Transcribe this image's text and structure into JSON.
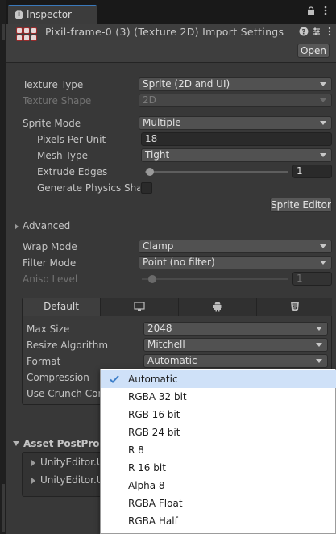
{
  "window": {
    "tab_label": "Inspector"
  },
  "header": {
    "title": "Pixil-frame-0 (3) (Texture 2D) Import Settings",
    "open_button": "Open"
  },
  "fields": {
    "texture_type": {
      "label": "Texture Type",
      "value": "Sprite (2D and UI)"
    },
    "texture_shape": {
      "label": "Texture Shape",
      "value": "2D"
    },
    "sprite_mode": {
      "label": "Sprite Mode",
      "value": "Multiple"
    },
    "pixels_per_unit": {
      "label": "Pixels Per Unit",
      "value": "18"
    },
    "mesh_type": {
      "label": "Mesh Type",
      "value": "Tight"
    },
    "extrude_edges": {
      "label": "Extrude Edges",
      "value": "1",
      "slider_fraction": 0.0
    },
    "generate_physics_shape": {
      "label": "Generate Physics Shap",
      "checked": false
    },
    "sprite_editor_button": "Sprite Editor",
    "advanced": {
      "label": "Advanced",
      "expanded": false
    },
    "wrap_mode": {
      "label": "Wrap Mode",
      "value": "Clamp"
    },
    "filter_mode": {
      "label": "Filter Mode",
      "value": "Point (no filter)"
    },
    "aniso_level": {
      "label": "Aniso Level",
      "value": "1",
      "slider_fraction": 0.0
    }
  },
  "platforms": {
    "tabs": [
      {
        "label": "Default",
        "icon": "",
        "selected": true
      },
      {
        "label": "",
        "icon": "monitor-icon",
        "selected": false
      },
      {
        "label": "",
        "icon": "android-icon",
        "selected": false
      },
      {
        "label": "",
        "icon": "html5-icon",
        "selected": false
      }
    ],
    "max_size": {
      "label": "Max Size",
      "value": "2048"
    },
    "resize_algorithm": {
      "label": "Resize Algorithm",
      "value": "Mitchell"
    },
    "format": {
      "label": "Format",
      "value": "Automatic"
    },
    "compression": {
      "label": "Compression"
    },
    "use_crunch": {
      "label": "Use Crunch Con"
    }
  },
  "postprocessor": {
    "title": "Asset PostProce",
    "items": [
      "UnityEditor.U",
      "UnityEditor.U"
    ]
  },
  "format_popup": {
    "selected": "Automatic",
    "options": [
      "Automatic",
      "RGBA 32 bit",
      "RGB 16 bit",
      "RGB 24 bit",
      "R 8",
      "R 16 bit",
      "Alpha 8",
      "RGBA Float",
      "RGBA Half"
    ]
  },
  "colors": {
    "accent": "#3a79bb",
    "popup_selection": "#cfe1f8",
    "checkmark": "#3d7fc9"
  }
}
